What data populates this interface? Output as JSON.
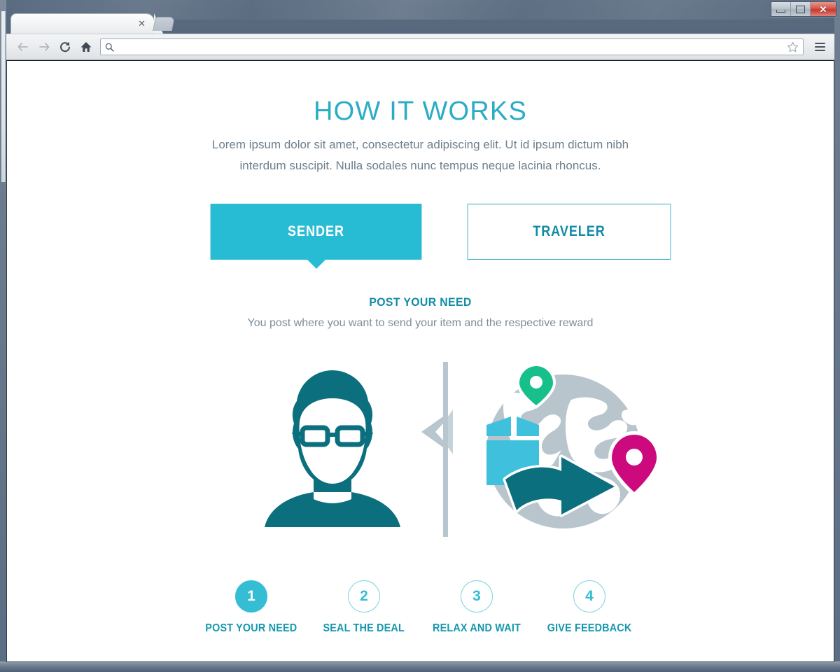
{
  "window": {
    "title_bar": {
      "minimize_label": "minimize",
      "maximize_label": "maximize",
      "close_label": "✕"
    }
  },
  "browser": {
    "tab": {
      "title": "",
      "close_label": "✕"
    },
    "new_tab_label": "",
    "nav": {
      "back_label": "back-arrow",
      "forward_label": "forward-arrow",
      "reload_label": "reload",
      "home_label": "home"
    },
    "address_bar": {
      "value": "",
      "placeholder": "",
      "search_icon": "search-icon",
      "bookmark_icon": "star-icon"
    },
    "menu_label": "menu"
  },
  "page": {
    "hero": {
      "title": "HOW IT WORKS",
      "subtitle": "Lorem ipsum dolor sit amet, consectetur adipiscing elit. Ut id ipsum dictum nibh interdum suscipit. Nulla sodales nunc tempus neque lacinia rhoncus."
    },
    "role_tabs": [
      {
        "label": "SENDER",
        "active": true
      },
      {
        "label": "TRAVELER",
        "active": false
      }
    ],
    "current_step": {
      "title": "POST YOUR NEED",
      "description": "You post where you want to send your item and the respective reward"
    },
    "steps": [
      {
        "number": "1",
        "label": "POST YOUR NEED",
        "active": true
      },
      {
        "number": "2",
        "label": "SEAL THE DEAL",
        "active": false
      },
      {
        "number": "3",
        "label": "RELAX AND WAIT",
        "active": false
      },
      {
        "number": "4",
        "label": "GIVE FEEDBACK",
        "active": false
      }
    ],
    "illustration": {
      "sender_avatar": "person-with-glasses-icon",
      "divider": "arrow-divider",
      "globe": "globe-icon",
      "package": "package-box-icon",
      "arrow": "curved-arrow-icon",
      "origin_pin": "map-pin-green-icon",
      "destination_pin": "map-pin-pink-icon"
    }
  },
  "colors": {
    "accent": "#28bcd4",
    "accent_dark": "#118ba4",
    "teal_deep": "#0a6a78",
    "grey_blue": "#6d7f8c",
    "globe_grey": "#b9c5cd",
    "pin_green": "#17c08a",
    "pin_pink": "#cc0a7e",
    "box_cyan": "#3fc0dd"
  }
}
